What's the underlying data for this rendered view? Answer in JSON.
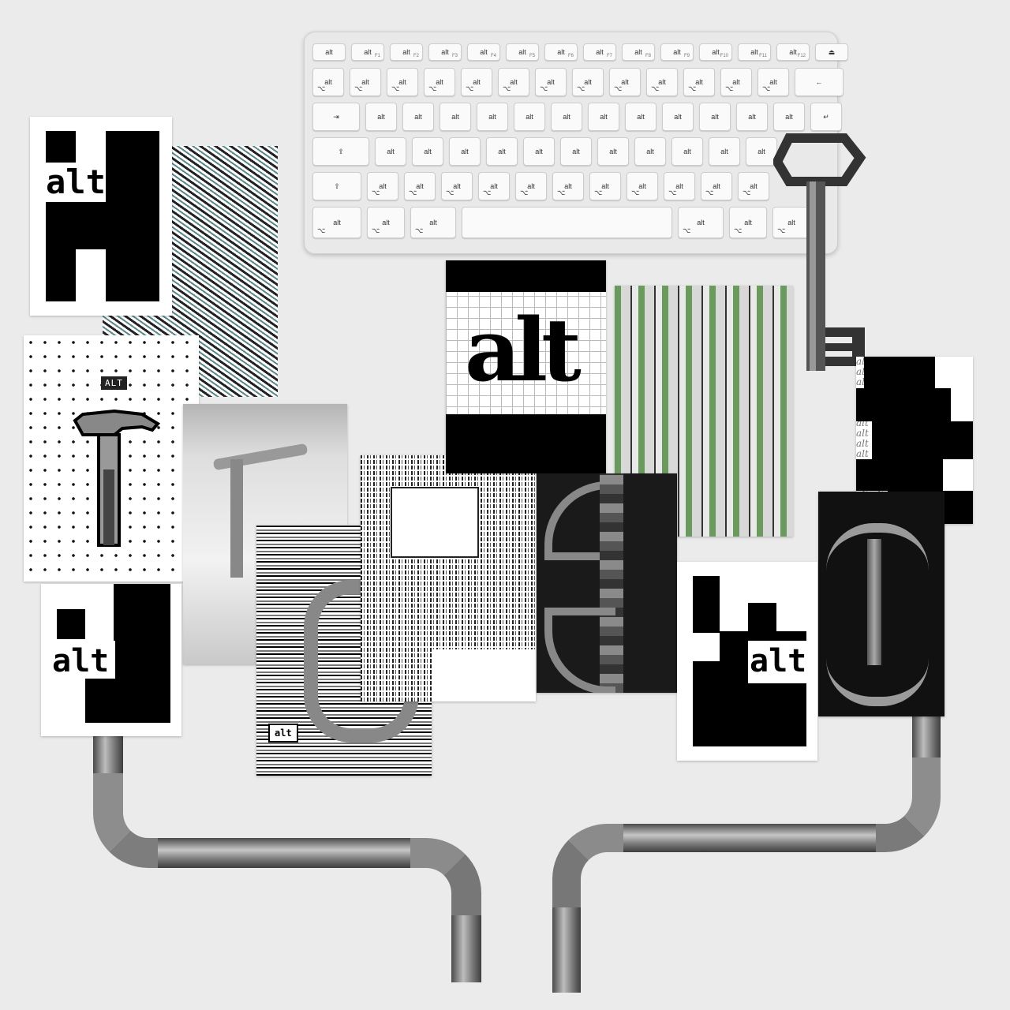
{
  "keyboard": {
    "fn_row": [
      "alt",
      "alt",
      "alt",
      "alt",
      "alt",
      "alt",
      "alt",
      "alt",
      "alt",
      "alt",
      "alt",
      "alt",
      "alt",
      "⏏"
    ],
    "fn_labels": [
      "",
      "F1",
      "F2",
      "F3",
      "F4",
      "F5",
      "F6",
      "F7",
      "F8",
      "F9",
      "F10",
      "F11",
      "F12",
      ""
    ],
    "num_row": [
      "alt",
      "alt",
      "alt",
      "alt",
      "alt",
      "alt",
      "alt",
      "alt",
      "alt",
      "alt",
      "alt",
      "alt",
      "alt",
      "←"
    ],
    "tab_row": [
      "⇥",
      "alt",
      "alt",
      "alt",
      "alt",
      "alt",
      "alt",
      "alt",
      "alt",
      "alt",
      "alt",
      "alt",
      "alt",
      "↵"
    ],
    "caps_row": [
      "⇪",
      "alt",
      "alt",
      "alt",
      "alt",
      "alt",
      "alt",
      "alt",
      "alt",
      "alt",
      "alt",
      "alt"
    ],
    "shift_row": [
      "⇧",
      "alt",
      "alt",
      "alt",
      "alt",
      "alt",
      "alt",
      "alt",
      "alt",
      "alt",
      "alt",
      "alt"
    ],
    "bottom_row": [
      "alt",
      "alt",
      "alt",
      "",
      "alt",
      "alt",
      "alt"
    ],
    "option_glyph": "⌥"
  },
  "cards": {
    "alt_top_left": "alt",
    "alt_bottom_left": "alt",
    "alt_bottom_right": "alt",
    "alt_grid": "alt",
    "alt_badge": "ALT",
    "alt_button": "alt",
    "alt_repeat": [
      "alt alt alt",
      "alt alt alt",
      "alt alt alt",
      "alt alt alt",
      "alt alt alt",
      "alt alt alt",
      "alt alt alt",
      "alt alt alt",
      "alt alt alt",
      "alt alt alt",
      "alt alt alt",
      "alt alt alt",
      "alt alt alt",
      "alt alt alt",
      "alt alt alt",
      "alt alt alt"
    ]
  },
  "colors": {
    "background": "#ebebeb",
    "ink": "#000000",
    "paper": "#ffffff",
    "metal": "#8a8a8a"
  },
  "icons": [
    "keyboard-icon",
    "key-icon",
    "hammer-icon",
    "allen-wrench-icon"
  ]
}
